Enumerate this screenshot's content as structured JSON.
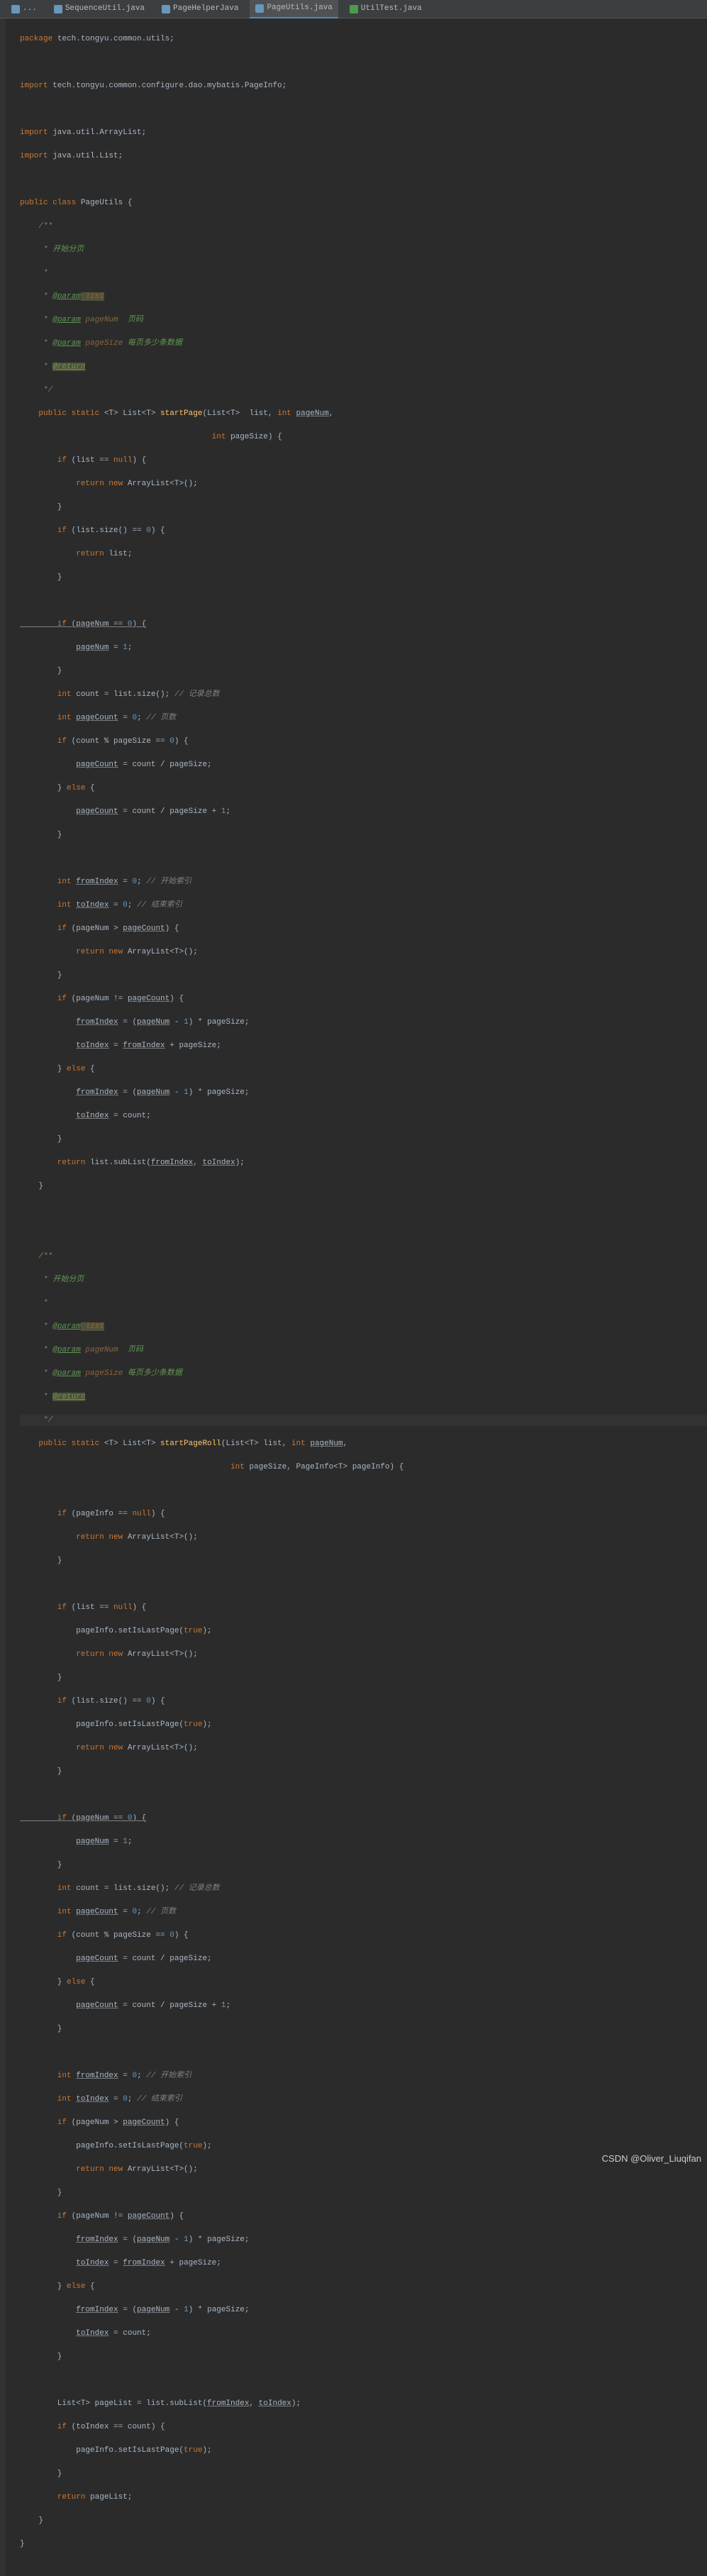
{
  "tabs": {
    "t1": "...",
    "t2": "SequenceUtil.java",
    "t3": "PageHelperJava",
    "t4": "PageUtils.java",
    "t5": "UtilTest.java"
  },
  "watermark": "CSDN @Oliver_Liuqifan",
  "code": {
    "l1_kw": "package",
    "l1_pkg": " tech.tongyu.common.utils;",
    "l3_kw": "import",
    "l3_pkg": " tech.tongyu.common.configure.dao.mybatis.PageInfo;",
    "l5_kw": "import",
    "l5_pkg": " java.util.ArrayList;",
    "l6_kw": "import",
    "l6_pkg": " java.util.List;",
    "l8_kw": "public class",
    "l8_cls": " PageUtils ",
    "l8_b": "{",
    "doc1_start": "    /**",
    "doc1_l1": "     * 开始分页",
    "doc1_l2": "     *",
    "doc1_l3a": "     * ",
    "doc1_l3b": "@param",
    "doc1_l3c": " list",
    "doc1_l4a": "     * ",
    "doc1_l4b": "@param",
    "doc1_l4c": " pageNum",
    "doc1_l4d": "  页码",
    "doc1_l5a": "     * ",
    "doc1_l5b": "@param",
    "doc1_l5c": " pageSize",
    "doc1_l5d": " 每页多少条数据",
    "doc1_l6a": "     * ",
    "doc1_l6b": "@return",
    "doc1_end": "     */",
    "m1_sig1": "    public static ",
    "m1_sig2": "<T> List<T> ",
    "m1_sig3": "startPage",
    "m1_sig4": "(List<T>  list, ",
    "m1_sig5": "int ",
    "m1_sig6": "pageNum",
    "m1_sig7": ",",
    "m1_sig8": "                                         ",
    "m1_sig9": "int ",
    "m1_sig10": "pageSize) {",
    "m1_l1a": "        if ",
    "m1_l1b": "(list == ",
    "m1_l1c": "null",
    "m1_l1d": ") {",
    "m1_l2a": "            return new ",
    "m1_l2b": "ArrayList<T>();",
    "m1_l3": "        }",
    "m1_l4a": "        if ",
    "m1_l4b": "(list.size() == ",
    "m1_l4c": "0",
    "m1_l4d": ") {",
    "m1_l5a": "            return ",
    "m1_l5b": "list;",
    "m1_l6": "        }",
    "m1_l8a": "        if ",
    "m1_l8b": "(pageNum == ",
    "m1_l8c": "0",
    "m1_l8d": ") {",
    "m1_l9a": "            ",
    "m1_l9b": "pageNum",
    "m1_l9c": " = ",
    "m1_l9d": "1",
    "m1_l9e": ";",
    "m1_l10": "        }",
    "m1_l11a": "        int ",
    "m1_l11b": "count = list.size(); ",
    "m1_l11c": "// 记录总数",
    "m1_l12a": "        int ",
    "m1_l12b": "pageCount",
    "m1_l12c": " = ",
    "m1_l12d": "0",
    "m1_l12e": "; ",
    "m1_l12f": "// 页数",
    "m1_l13a": "        if ",
    "m1_l13b": "(count % pageSize == ",
    "m1_l13c": "0",
    "m1_l13d": ") {",
    "m1_l14a": "            ",
    "m1_l14b": "pageCount",
    "m1_l14c": " = count / pageSize;",
    "m1_l15a": "        } ",
    "m1_l15b": "else ",
    "m1_l15c": "{",
    "m1_l16a": "            ",
    "m1_l16b": "pageCount",
    "m1_l16c": " = count / pageSize + ",
    "m1_l16d": "1",
    "m1_l16e": ";",
    "m1_l17": "        }",
    "m1_l19a": "        int ",
    "m1_l19b": "fromIndex",
    "m1_l19c": " = ",
    "m1_l19d": "0",
    "m1_l19e": "; ",
    "m1_l19f": "// 开始索引",
    "m1_l20a": "        int ",
    "m1_l20b": "toIndex",
    "m1_l20c": " = ",
    "m1_l20d": "0",
    "m1_l20e": "; ",
    "m1_l20f": "// 结束索引",
    "m1_l21a": "        if ",
    "m1_l21b": "(pageNum > ",
    "m1_l21c": "pageCount",
    "m1_l21d": ") {",
    "m1_l22a": "            return new ",
    "m1_l22b": "ArrayList<T>();",
    "m1_l23": "        }",
    "m1_l24a": "        if ",
    "m1_l24b": "(pageNum != ",
    "m1_l24c": "pageCount",
    "m1_l24d": ") {",
    "m1_l25a": "            ",
    "m1_l25b": "fromIndex",
    "m1_l25c": " = (",
    "m1_l25d": "pageNum",
    "m1_l25e": " - ",
    "m1_l25f": "1",
    "m1_l25g": ") * pageSize;",
    "m1_l26a": "            ",
    "m1_l26b": "toIndex",
    "m1_l26c": " = ",
    "m1_l26d": "fromIndex",
    "m1_l26e": " + pageSize;",
    "m1_l27a": "        } ",
    "m1_l27b": "else ",
    "m1_l27c": "{",
    "m1_l28a": "            ",
    "m1_l28b": "fromIndex",
    "m1_l28c": " = (",
    "m1_l28d": "pageNum",
    "m1_l28e": " - ",
    "m1_l28f": "1",
    "m1_l28g": ") * pageSize;",
    "m1_l29a": "            ",
    "m1_l29b": "toIndex",
    "m1_l29c": " = count;",
    "m1_l30": "        }",
    "m1_l31a": "        return ",
    "m1_l31b": "list.subList(",
    "m1_l31c": "fromIndex",
    "m1_l31d": ", ",
    "m1_l31e": "toIndex",
    "m1_l31f": ");",
    "m1_l32": "    }",
    "doc2_start": "    /**",
    "doc2_l1": "     * 开始分页",
    "doc2_l2": "     *",
    "doc2_l3a": "     * ",
    "doc2_l3b": "@param",
    "doc2_l3c": " list",
    "doc2_l4a": "     * ",
    "doc2_l4b": "@param",
    "doc2_l4c": " pageNum",
    "doc2_l4d": "  页码",
    "doc2_l5a": "     * ",
    "doc2_l5b": "@param",
    "doc2_l5c": " pageSize",
    "doc2_l5d": " 每页多少条数据",
    "doc2_l6a": "     * ",
    "doc2_l6b": "@return",
    "doc2_end": "     */",
    "m2_sig1": "    public static ",
    "m2_sig2": "<T> List<T> ",
    "m2_sig3": "startPageRoll",
    "m2_sig4": "(List<T> list, ",
    "m2_sig5": "int ",
    "m2_sig6": "pageNum",
    "m2_sig7": ",",
    "m2_sig8": "                                             ",
    "m2_sig9": "int ",
    "m2_sig10": "pageSize, PageInfo<T> pageInfo) {",
    "m2_l1a": "        if ",
    "m2_l1b": "(pageInfo == ",
    "m2_l1c": "null",
    "m2_l1d": ") {",
    "m2_l2a": "            return new ",
    "m2_l2b": "ArrayList<T>();",
    "m2_l3": "        }",
    "m2_l5a": "        if ",
    "m2_l5b": "(list == ",
    "m2_l5c": "null",
    "m2_l5d": ") {",
    "m2_l6a": "            pageInfo.setIsLastPage(",
    "m2_l6b": "true",
    "m2_l6c": ");",
    "m2_l7a": "            return new ",
    "m2_l7b": "ArrayList<T>();",
    "m2_l8": "        }",
    "m2_l9a": "        if ",
    "m2_l9b": "(list.size() == ",
    "m2_l9c": "0",
    "m2_l9d": ") {",
    "m2_l10a": "            pageInfo.setIsLastPage(",
    "m2_l10b": "true",
    "m2_l10c": ");",
    "m2_l11a": "            return new ",
    "m2_l11b": "ArrayList<T>();",
    "m2_l12": "        }",
    "m2_l14a": "        if ",
    "m2_l14b": "(pageNum == ",
    "m2_l14c": "0",
    "m2_l14d": ") {",
    "m2_l15a": "            ",
    "m2_l15b": "pageNum",
    "m2_l15c": " = ",
    "m2_l15d": "1",
    "m2_l15e": ";",
    "m2_l16": "        }",
    "m2_l17a": "        int ",
    "m2_l17b": "count = list.size(); ",
    "m2_l17c": "// 记录总数",
    "m2_l18a": "        int ",
    "m2_l18b": "pageCount",
    "m2_l18c": " = ",
    "m2_l18d": "0",
    "m2_l18e": "; ",
    "m2_l18f": "// 页数",
    "m2_l19a": "        if ",
    "m2_l19b": "(count % pageSize == ",
    "m2_l19c": "0",
    "m2_l19d": ") {",
    "m2_l20a": "            ",
    "m2_l20b": "pageCount",
    "m2_l20c": " = count / pageSize;",
    "m2_l21a": "        } ",
    "m2_l21b": "else ",
    "m2_l21c": "{",
    "m2_l22a": "            ",
    "m2_l22b": "pageCount",
    "m2_l22c": " = count / pageSize + ",
    "m2_l22d": "1",
    "m2_l22e": ";",
    "m2_l23": "        }",
    "m2_l25a": "        int ",
    "m2_l25b": "fromIndex",
    "m2_l25c": " = ",
    "m2_l25d": "0",
    "m2_l25e": "; ",
    "m2_l25f": "// 开始索引",
    "m2_l26a": "        int ",
    "m2_l26b": "toIndex",
    "m2_l26c": " = ",
    "m2_l26d": "0",
    "m2_l26e": "; ",
    "m2_l26f": "// 结束索引",
    "m2_l27a": "        if ",
    "m2_l27b": "(pageNum > ",
    "m2_l27c": "pageCount",
    "m2_l27d": ") {",
    "m2_l28a": "            pageInfo.setIsLastPage(",
    "m2_l28b": "true",
    "m2_l28c": ");",
    "m2_l29a": "            return new ",
    "m2_l29b": "ArrayList<T>();",
    "m2_l30": "        }",
    "m2_l31a": "        if ",
    "m2_l31b": "(pageNum != ",
    "m2_l31c": "pageCount",
    "m2_l31d": ") {",
    "m2_l32a": "            ",
    "m2_l32b": "fromIndex",
    "m2_l32c": " = (",
    "m2_l32d": "pageNum",
    "m2_l32e": " - ",
    "m2_l32f": "1",
    "m2_l32g": ") * pageSize;",
    "m2_l33a": "            ",
    "m2_l33b": "toIndex",
    "m2_l33c": " = ",
    "m2_l33d": "fromIndex",
    "m2_l33e": " + pageSize;",
    "m2_l34a": "        } ",
    "m2_l34b": "else ",
    "m2_l34c": "{",
    "m2_l35a": "            ",
    "m2_l35b": "fromIndex",
    "m2_l35c": " = (",
    "m2_l35d": "pageNum",
    "m2_l35e": " - ",
    "m2_l35f": "1",
    "m2_l35g": ") * pageSize;",
    "m2_l36a": "            ",
    "m2_l36b": "toIndex",
    "m2_l36c": " = count;",
    "m2_l37": "        }",
    "m2_l39a": "        List<T> pageList = list.subList(",
    "m2_l39b": "fromIndex",
    "m2_l39c": ", ",
    "m2_l39d": "toIndex",
    "m2_l39e": ");",
    "m2_l40a": "        if ",
    "m2_l40b": "(toIndex == count) {",
    "m2_l41a": "            pageInfo.setIsLastPage(",
    "m2_l41b": "true",
    "m2_l41c": ");",
    "m2_l42": "        }",
    "m2_l43a": "        return ",
    "m2_l43b": "pageList;",
    "m2_l44": "    }",
    "cls_end": "}"
  }
}
